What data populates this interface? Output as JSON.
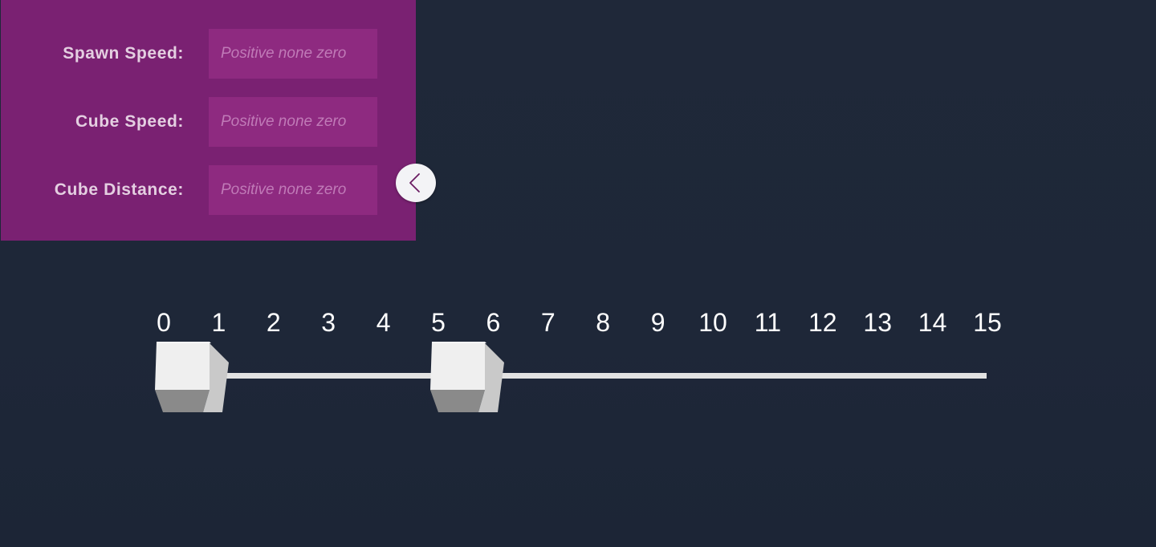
{
  "settings_panel": {
    "fields": [
      {
        "label": "Spawn Speed:",
        "value": "",
        "placeholder": "Positive none zero"
      },
      {
        "label": "Cube Speed:",
        "value": "",
        "placeholder": "Positive none zero"
      },
      {
        "label": "Cube Distance:",
        "value": "",
        "placeholder": "Positive none zero"
      }
    ],
    "collapse_icon": "chevron-left-icon"
  },
  "number_line": {
    "ticks": [
      "0",
      "1",
      "2",
      "3",
      "4",
      "5",
      "6",
      "7",
      "8",
      "9",
      "10",
      "11",
      "12",
      "13",
      "14",
      "15"
    ],
    "cube_positions": [
      0,
      5
    ]
  },
  "colors": {
    "background": "#1e2739",
    "panel": "#7a2172",
    "input": "#8e2a80",
    "track": "#e2e2e2",
    "cube_face": "#eeeeee"
  }
}
